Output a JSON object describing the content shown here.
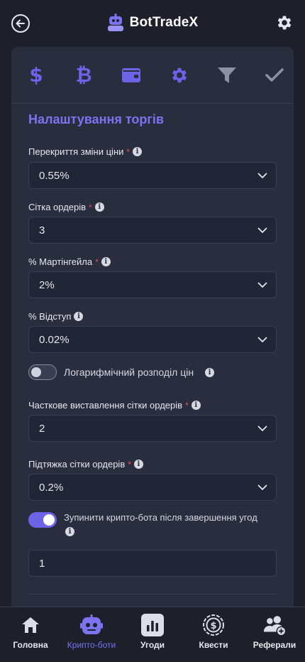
{
  "app": {
    "brand": "BotTradeX"
  },
  "tabs": [
    {
      "icon": "dollar-icon",
      "glyph": "$"
    },
    {
      "icon": "bitcoin-icon",
      "glyph": "₿"
    },
    {
      "icon": "wallet-icon"
    },
    {
      "icon": "gear-icon"
    },
    {
      "icon": "filter-icon"
    },
    {
      "icon": "check-icon"
    }
  ],
  "section": {
    "title": "Налаштування торгів"
  },
  "fields": {
    "price_overlap": {
      "label": "Перекриття зміни ціни",
      "required": "*",
      "value": "0.55%"
    },
    "order_grid": {
      "label": "Сітка ордерів",
      "required": "*",
      "value": "3"
    },
    "martingale": {
      "label": "% Мартінгейла",
      "required": "*",
      "value": "2%"
    },
    "offset": {
      "label": "% Відступ",
      "value": "0.02%"
    },
    "log_distribution": {
      "label": "Логарифмічний розподіл цін",
      "enabled": false
    },
    "partial_grid": {
      "label": "Часткове виставлення сітки ордерів",
      "required": "*",
      "value": "2"
    },
    "grid_pullup": {
      "label": "Підтяжка сітки ордерів",
      "required": "*",
      "value": "0.2%"
    },
    "stop_after_deals": {
      "label": "Зупинити крипто-бота після завершення угод",
      "enabled": true,
      "value": "1"
    }
  },
  "info_glyph": "i",
  "nav": [
    {
      "label": "Головна",
      "icon": "home-icon",
      "active": false
    },
    {
      "label": "Крипто-боти",
      "icon": "robot-icon",
      "active": true
    },
    {
      "label": "Угоди",
      "icon": "chart-icon",
      "active": false
    },
    {
      "label": "Квести",
      "icon": "coin-icon",
      "active": false
    },
    {
      "label": "Реферали",
      "icon": "users-add-icon",
      "active": false
    }
  ],
  "colors": {
    "accent": "#6c63e8",
    "background": "#1d1f2b",
    "card": "#2a2d3e",
    "required": "#e05555"
  }
}
